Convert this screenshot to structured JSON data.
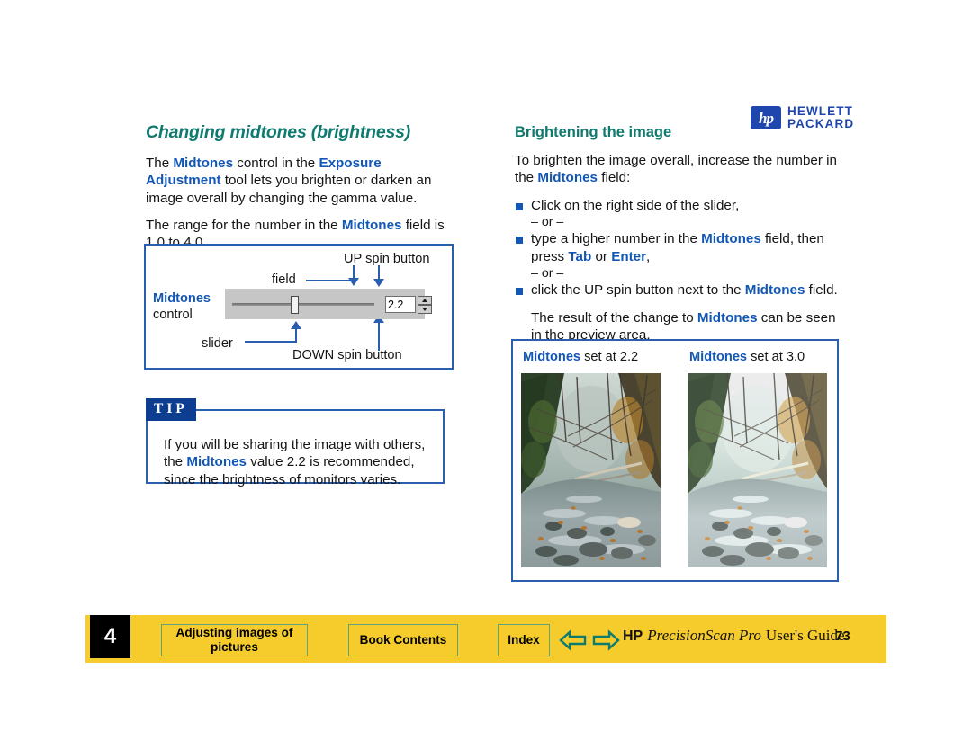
{
  "logo": {
    "mark": "hp",
    "line1": "HEWLETT",
    "line2": "PACKARD",
    "color": "#1f46ad"
  },
  "left_column": {
    "title": "Changing midtones (brightness)",
    "paragraph1_parts": [
      {
        "t": "The ",
        "k": false
      },
      {
        "t": "Midtones",
        "k": true
      },
      {
        "t": " control in the ",
        "k": false
      },
      {
        "t": "Exposure Adjustment",
        "k": true
      },
      {
        "t": " tool lets you brighten or darken an image overall by changing the gamma value.",
        "k": false
      }
    ],
    "paragraph2_parts": [
      {
        "t": "The range for the number in the ",
        "k": false
      },
      {
        "t": "Midtones",
        "k": true
      },
      {
        "t": " field is 1.0 to 4.0.",
        "k": false
      }
    ]
  },
  "diagram": {
    "label_up_spin": "UP spin button",
    "label_field": "field",
    "label_midtones_kw": "Midtones",
    "label_midtones_rest": "control",
    "label_slider": "slider",
    "label_down_spin": "DOWN spin button",
    "field_value": "2.2",
    "border_color": "#2a5fb0"
  },
  "tip": {
    "badge": "TIP",
    "text_parts": [
      {
        "t": "If you will be sharing the image with others, the ",
        "k": false
      },
      {
        "t": "Midtones",
        "k": true
      },
      {
        "t": " value 2.2 is recommended, since the brightness of monitors varies.",
        "k": false
      }
    ]
  },
  "right_column": {
    "title": "Brightening the image",
    "intro_parts": [
      {
        "t": "To brighten the image overall, increase the number in the ",
        "k": false
      },
      {
        "t": "Midtones",
        "k": true
      },
      {
        "t": " field:",
        "k": false
      }
    ],
    "bullets": [
      {
        "parts": [
          {
            "t": "Click on the right side of the slider,",
            "k": false
          }
        ],
        "or_after": "– or –"
      },
      {
        "parts": [
          {
            "t": "type a higher number in the ",
            "k": false
          },
          {
            "t": "Midtones",
            "k": true
          },
          {
            "t": " field, then press ",
            "k": false
          },
          {
            "t": "Tab",
            "k": true
          },
          {
            "t": " or ",
            "k": false
          },
          {
            "t": "Enter",
            "k": true
          },
          {
            "t": ",",
            "k": false
          }
        ],
        "or_after": "– or –"
      },
      {
        "parts": [
          {
            "t": "click the UP spin button next to the ",
            "k": false
          },
          {
            "t": "Midtones",
            "k": true
          },
          {
            "t": " field.",
            "k": false
          }
        ],
        "or_after": ""
      }
    ],
    "closing_parts": [
      {
        "t": "The result of the change to ",
        "k": false
      },
      {
        "t": "Midtones",
        "k": true
      },
      {
        "t": " can be seen in the preview area.",
        "k": false
      }
    ]
  },
  "compare": {
    "caption_a_kw": "Midtones",
    "caption_a_rest": " set at 2.2",
    "caption_b_kw": "Midtones",
    "caption_b_rest": " set at 3.0",
    "photo_alt": "forest-stream-photo"
  },
  "footer": {
    "chapter_number": "4",
    "chapter_title": "Adjusting images of pictures",
    "book_contents": "Book Contents",
    "index": "Index",
    "hp": "HP",
    "product": "PrecisionScan Pro",
    "guide": "User's Guide",
    "page_number": "73",
    "bar_color": "#f5cc2b",
    "button_border": "#5ea37f",
    "arrow_color": "#0f7a6e"
  }
}
